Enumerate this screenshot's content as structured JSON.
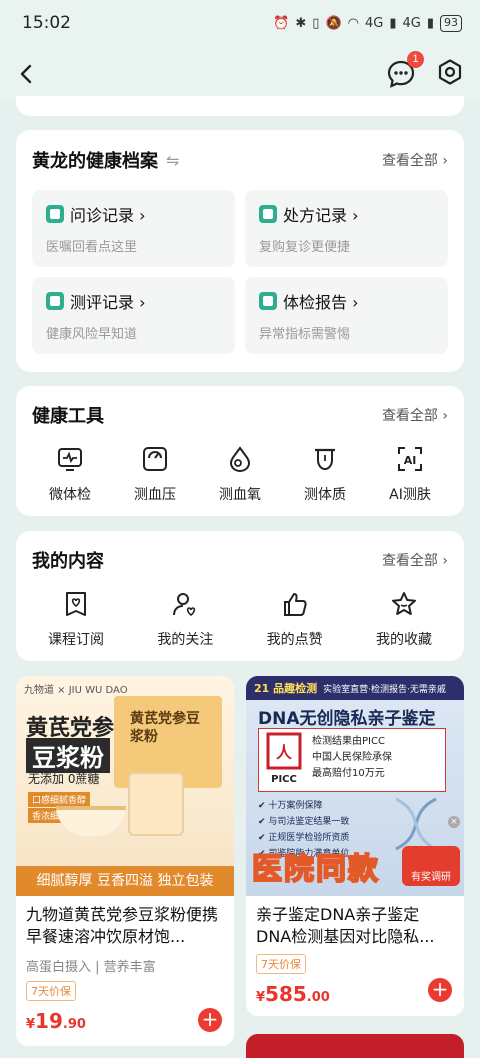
{
  "status_bar": {
    "time": "15:02",
    "battery": "93",
    "network_1": "4G",
    "network_2": "4G"
  },
  "navbar": {
    "message_badge": "1"
  },
  "health_record": {
    "title": "黄龙的健康档案",
    "more": "查看全部 ›",
    "items": [
      {
        "title": "问诊记录 ›",
        "subtitle": "医嘱回看点这里"
      },
      {
        "title": "处方记录 ›",
        "subtitle": "复购复诊更便捷"
      },
      {
        "title": "测评记录 ›",
        "subtitle": "健康风险早知道"
      },
      {
        "title": "体检报告 ›",
        "subtitle": "异常指标需警惕"
      }
    ]
  },
  "health_tools": {
    "title": "健康工具",
    "more": "查看全部 ›",
    "items": [
      {
        "label": "微体检",
        "icon": "monitor-pulse-icon"
      },
      {
        "label": "测血压",
        "icon": "blood-pressure-icon"
      },
      {
        "label": "测血氧",
        "icon": "blood-oxygen-icon"
      },
      {
        "label": "测体质",
        "icon": "tongue-icon"
      },
      {
        "label": "AI测肤",
        "icon": "ai-scan-icon"
      }
    ]
  },
  "my_content": {
    "title": "我的内容",
    "more": "查看全部 ›",
    "items": [
      {
        "label": "课程订阅",
        "icon": "course-heart-icon"
      },
      {
        "label": "我的关注",
        "icon": "follow-person-icon"
      },
      {
        "label": "我的点赞",
        "icon": "thumbs-up-icon"
      },
      {
        "label": "我的收藏",
        "icon": "star-icon"
      }
    ]
  },
  "products": [
    {
      "brand": "九物道 × JIU WU DAO",
      "banner_line1": "黄芪党参",
      "banner_line2": "豆浆粉",
      "banner_line3": "无添加 0蔗糖",
      "box_text": "黄芪党参豆浆粉",
      "chip1": "口感细腻香醇",
      "chip2": "香浓细腻易溶",
      "features": "细腻醇厚 豆香四溢 独立包装",
      "name": "九物道黄芪党参豆浆粉便携早餐速溶冲饮原材饱...",
      "tags": "高蛋白摄入 | 营养丰富",
      "badge": "7天价保",
      "price_symbol": "¥",
      "price_int": "19",
      "price_dec": ".90"
    },
    {
      "banner_logo": "21 品趣检测",
      "banner_extra": "实验室直营·检测报告·无需亲戚",
      "headline": "DNA无创隐私亲子鉴定",
      "panel_lines": [
        "检测结果由PICC",
        "中国人民保险承保",
        "最高赔付10万元"
      ],
      "picc": "PICC",
      "bullets": [
        "✔ 十万案例保障",
        "✔ 与司法鉴定结果一致",
        "✔ 正规医学检验所资质",
        "✔ 司鉴院能力满意单位"
      ],
      "footer": "医院同款",
      "prize": "有奖调研",
      "name": "亲子鉴定DNA亲子鉴定DNA检测基因对比隐私...",
      "badge": "7天价保",
      "price_symbol": "¥",
      "price_int": "585",
      "price_dec": ".00"
    }
  ]
}
